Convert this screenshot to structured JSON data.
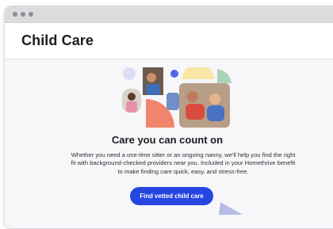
{
  "window": {
    "controls": [
      "close",
      "minimize",
      "maximize"
    ]
  },
  "header": {
    "title": "Child Care"
  },
  "main": {
    "headline": "Care you can count on",
    "description": "Whether you need a one-time sitter or an ongoing nanny, we'll help you find the right fit with background-checked providers near you. Included in your Homethrive benefit to make finding care quick, easy, and stress-free.",
    "cta_label": "Find vetted child care",
    "hero_image": "collage of caregivers with children and abstract shapes"
  },
  "colors": {
    "accent": "#2546e0",
    "title_text": "#1c1d22",
    "background": "#f7f7f9",
    "shape_lavender": "#dcdcf5",
    "shape_coral": "#f2846d",
    "shape_yellow": "#fbe6a8",
    "shape_green": "#a9d4b8",
    "shape_blue": "#4d66f0"
  }
}
